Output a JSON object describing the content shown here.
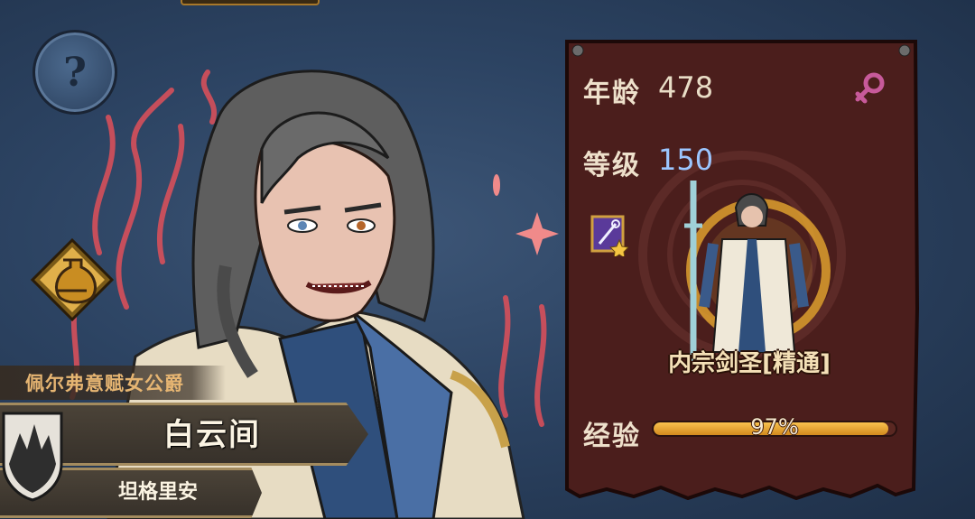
{
  "character": {
    "title": "佩尔弗意赋女公爵",
    "name": "白云间",
    "location": "坦格里安"
  },
  "help": {
    "icon": "question-icon",
    "label": "?"
  },
  "stats": {
    "age_label": "年龄",
    "age_value": "478",
    "level_label": "等级",
    "level_value": "150",
    "gender_icon": "female-icon",
    "exp_label": "经验",
    "exp_value": "97%",
    "exp_fraction": 0.97
  },
  "class": {
    "name": "内宗剑圣[精通]",
    "skill_icon": "staff-star-icon"
  },
  "colors": {
    "panel_bg": "#4a1d1c",
    "level_value": "#9bc6ff",
    "exp_fill": "#e8a838",
    "gender": "#c75a9a"
  }
}
